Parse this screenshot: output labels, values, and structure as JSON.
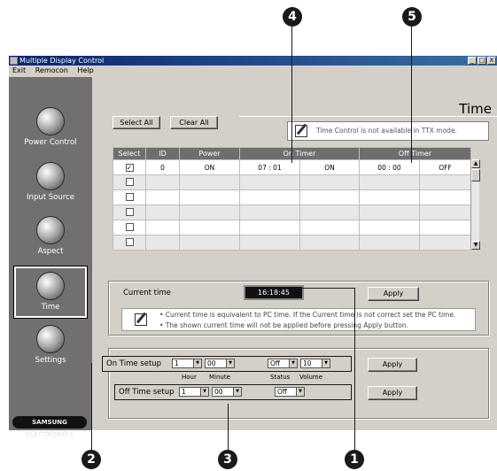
{
  "window": {
    "title": "Multiple Display Control",
    "buttons": [
      "_",
      "□",
      "X"
    ]
  },
  "menu": [
    "Exit",
    "Remocon",
    "Help"
  ],
  "sidebar": {
    "items": [
      {
        "label": "Power Control",
        "icon": "power-icon"
      },
      {
        "label": "Input Source",
        "icon": "input-source-icon"
      },
      {
        "label": "Aspect",
        "icon": "aspect-icon"
      },
      {
        "label": "Time",
        "icon": "clock-icon"
      },
      {
        "label": "Settings",
        "icon": "settings-icon"
      }
    ],
    "active": "Time",
    "logo": "SAMSUNG ELECTRONICS"
  },
  "page": {
    "heading": "Time",
    "select_all": "Select All",
    "clear_all": "Clear All",
    "note": "Time Control is not available in TTX mode."
  },
  "table": {
    "headers": [
      "Select",
      "ID",
      "Power",
      "On Timer",
      "Off Timer"
    ],
    "rows": [
      {
        "checked": true,
        "id": "0",
        "power": "ON",
        "on_time": "07 : 01",
        "on_status": "ON",
        "off_time": "00 : 00",
        "off_status": "OFF"
      },
      {
        "checked": false,
        "id": "",
        "power": "",
        "on_time": "",
        "on_status": "",
        "off_time": "",
        "off_status": ""
      },
      {
        "checked": false,
        "id": "",
        "power": "",
        "on_time": "",
        "on_status": "",
        "off_time": "",
        "off_status": ""
      },
      {
        "checked": false,
        "id": "",
        "power": "",
        "on_time": "",
        "on_status": "",
        "off_time": "",
        "off_status": ""
      },
      {
        "checked": false,
        "id": "",
        "power": "",
        "on_time": "",
        "on_status": "",
        "off_time": "",
        "off_status": ""
      },
      {
        "checked": false,
        "id": "",
        "power": "",
        "on_time": "",
        "on_status": "",
        "off_time": "",
        "off_status": ""
      }
    ]
  },
  "current_time": {
    "label": "Current time",
    "value": "16:18:45",
    "apply": "Apply",
    "info_line1": "• Current time is equivalent to PC time. If the Current time is not correct set the PC time.",
    "info_line2": "• The shown current time will not be applied before pressing Apply button."
  },
  "on_time_setup": {
    "label": "On Time setup",
    "hour": "1",
    "minute": "00",
    "status": "Off",
    "volume": "10",
    "apply": "Apply",
    "sub_hour": "Hour",
    "sub_minute": "Minute",
    "sub_status": "Status",
    "sub_volume": "Volume"
  },
  "off_time_setup": {
    "label": "Off Time setup",
    "hour": "1",
    "minute": "00",
    "status": "Off",
    "apply": "Apply"
  },
  "callouts": [
    "1",
    "2",
    "3",
    "4",
    "5"
  ]
}
